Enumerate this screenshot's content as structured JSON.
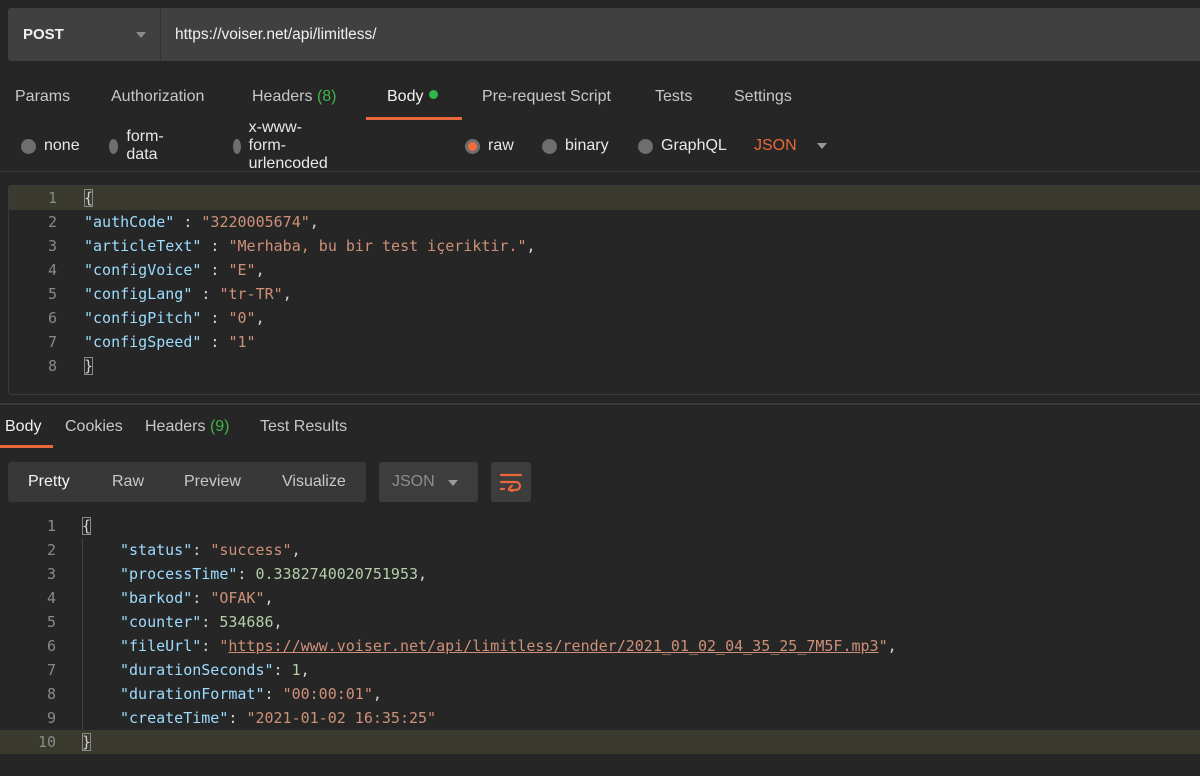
{
  "request": {
    "method": "POST",
    "url": "https://voiser.net/api/limitless/"
  },
  "request_tabs": [
    {
      "label": "Params"
    },
    {
      "label": "Authorization"
    },
    {
      "label": "Headers",
      "count": "(8)"
    },
    {
      "label": "Body",
      "active": true,
      "indicator": "green-dot"
    },
    {
      "label": "Pre-request Script"
    },
    {
      "label": "Tests"
    },
    {
      "label": "Settings"
    }
  ],
  "body_types": {
    "options": [
      "none",
      "form-data",
      "x-www-form-urlencoded",
      "raw",
      "binary",
      "GraphQL"
    ],
    "selected": "raw",
    "language": "JSON"
  },
  "request_body": {
    "line_numbers": [
      "1",
      "2",
      "3",
      "4",
      "5",
      "6",
      "7",
      "8"
    ],
    "open_brace": "{",
    "close_brace": "}",
    "fields": [
      {
        "key": "\"authCode\"",
        "sep": " : ",
        "value": "\"3220005674\"",
        "trail": ","
      },
      {
        "key": "\"articleText\"",
        "sep": " : ",
        "value": "\"Merhaba, bu bir test içeriktir.\"",
        "trail": ","
      },
      {
        "key": "\"configVoice\"",
        "sep": " : ",
        "value": "\"E\"",
        "trail": ","
      },
      {
        "key": "\"configLang\"",
        "sep": " : ",
        "value": "\"tr-TR\"",
        "trail": ","
      },
      {
        "key": "\"configPitch\"",
        "sep": " : ",
        "value": "\"0\"",
        "trail": ","
      },
      {
        "key": "\"configSpeed\"",
        "sep": " : ",
        "value": "\"1\"",
        "trail": ""
      }
    ]
  },
  "response_tabs": [
    {
      "label": "Body",
      "active": true
    },
    {
      "label": "Cookies"
    },
    {
      "label": "Headers",
      "count": "(9)"
    },
    {
      "label": "Test Results"
    }
  ],
  "response_views": {
    "options": [
      "Pretty",
      "Raw",
      "Preview",
      "Visualize"
    ],
    "selected": "Pretty",
    "format": "JSON",
    "wrap_icon": "wrap-lines-icon"
  },
  "response_body": {
    "line_numbers": [
      "1",
      "2",
      "3",
      "4",
      "5",
      "6",
      "7",
      "8",
      "9",
      "10"
    ],
    "open_brace": "{",
    "close_brace": "}",
    "fields": [
      {
        "key": "\"status\"",
        "sep": ": ",
        "value": "\"success\"",
        "type": "str",
        "trail": ","
      },
      {
        "key": "\"processTime\"",
        "sep": ": ",
        "value": "0.3382740020751953",
        "type": "num",
        "trail": ","
      },
      {
        "key": "\"barkod\"",
        "sep": ": ",
        "value": "\"OFAK\"",
        "type": "str",
        "trail": ","
      },
      {
        "key": "\"counter\"",
        "sep": ": ",
        "value": "534686",
        "type": "num",
        "trail": ","
      },
      {
        "key": "\"fileUrl\"",
        "sep": ": ",
        "value_prefix": "\"",
        "value": "https://www.voiser.net/api/limitless/render/2021_01_02_04_35_25_7M5F.mp3",
        "value_suffix": "\"",
        "type": "link",
        "trail": ","
      },
      {
        "key": "\"durationSeconds\"",
        "sep": ": ",
        "value": "1",
        "type": "num",
        "trail": ","
      },
      {
        "key": "\"durationFormat\"",
        "sep": ": ",
        "value": "\"00:00:01\"",
        "type": "str",
        "trail": ","
      },
      {
        "key": "\"createTime\"",
        "sep": ": ",
        "value": "\"2021-01-02 16:35:25\"",
        "type": "str",
        "trail": ""
      }
    ]
  }
}
